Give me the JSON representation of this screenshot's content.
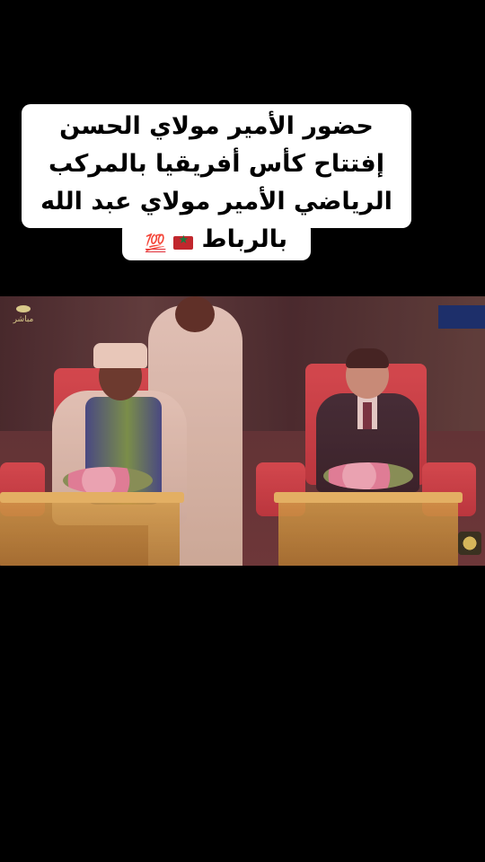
{
  "caption": {
    "lines": [
      "حضور الأمير مولاي الحسن",
      "إفتتاح كأس أفريقيا بالمركب",
      "الرياضي الأمير مولاي عبد الله",
      "بالرباط"
    ],
    "emoji_hundred": "💯",
    "flag": "morocco-flag-icon"
  },
  "video": {
    "live_label": "مباشر"
  },
  "colors": {
    "background": "#000000",
    "caption_bg": "#ffffff",
    "chair_red": "#d64a4f",
    "table_gold": "#d8b24a"
  }
}
